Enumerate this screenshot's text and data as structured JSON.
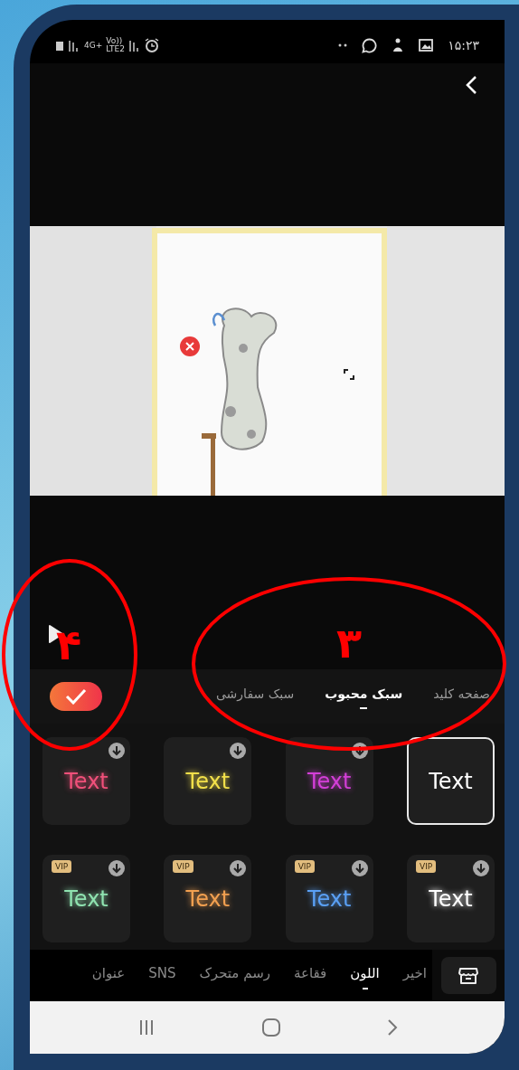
{
  "status_bar": {
    "network": [
      "Vo))",
      "LTE2",
      "4G+"
    ],
    "time": "۱۵:۲۳"
  },
  "style_tabs": [
    {
      "label": "صفحه کلید",
      "selected": false
    },
    {
      "label": "سبک محبوب",
      "selected": true
    },
    {
      "label": "سبک سفارشی",
      "selected": false
    }
  ],
  "styles": [
    {
      "label": "Text",
      "color": "#ffffff",
      "download": false,
      "selected": true
    },
    {
      "label": "Text",
      "color": "#d43fd8",
      "download": true,
      "selected": false
    },
    {
      "label": "Text",
      "color": "#f2e04a",
      "download": true,
      "selected": false
    },
    {
      "label": "Text",
      "color": "#f0507a",
      "download": true,
      "selected": false
    },
    {
      "badge": "VIP",
      "label": "Text",
      "color": "#ffffff",
      "download": true,
      "selected": false
    },
    {
      "badge": "VIP",
      "label": "Text",
      "color": "#5aa0f5",
      "download": true,
      "selected": false
    },
    {
      "badge": "VIP",
      "label": "Text",
      "color": "#f2a050",
      "download": true,
      "selected": false
    },
    {
      "badge": "VIP",
      "label": "Text",
      "color": "#8fe3b0",
      "download": true,
      "selected": false
    }
  ],
  "categories": [
    {
      "label": "اخیر",
      "selected": false
    },
    {
      "label": "اللون",
      "selected": true
    },
    {
      "label": "فقاعة",
      "selected": false
    },
    {
      "label": "رسم متحرک",
      "selected": false
    },
    {
      "label": "SNS",
      "selected": false
    },
    {
      "label": "عنوان",
      "selected": false
    }
  ],
  "annotations": [
    {
      "label": "۳"
    },
    {
      "label": "۴"
    }
  ]
}
